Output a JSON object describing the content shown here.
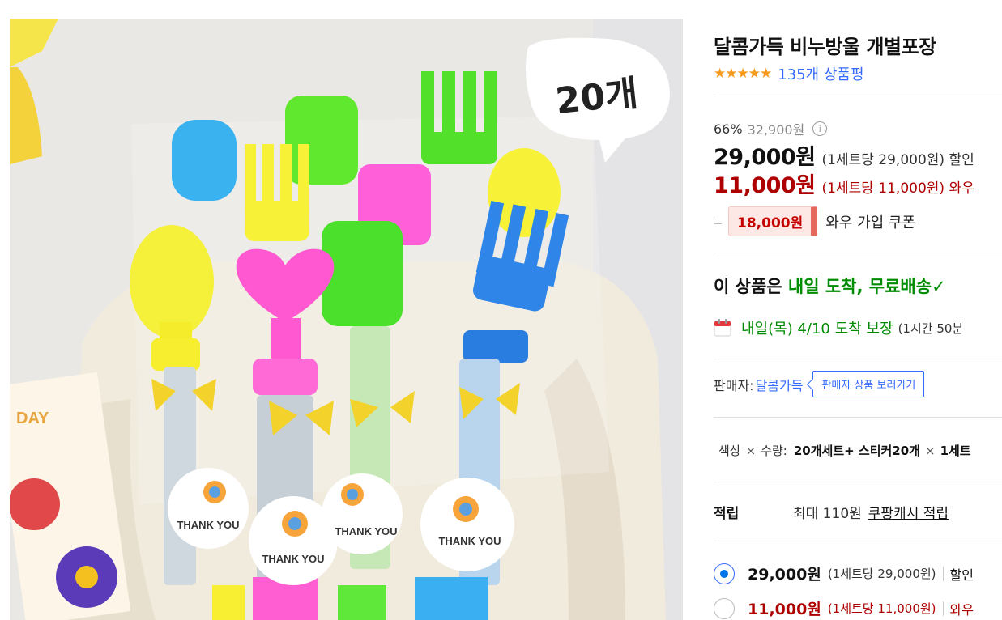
{
  "product": {
    "title": "달콤가득 비누방울 개별포장",
    "image_overlay": {
      "count_badge": "20개",
      "sticker_text": "THANK YOU",
      "card_text": "DAY"
    }
  },
  "rating": {
    "stars_text": "★★★★★",
    "stars_value": 4.5,
    "review_count": "135개 상품평"
  },
  "pricing": {
    "discount_rate": "66%",
    "original_price": "32,900원",
    "info_icon": "ⓘ",
    "normal_price": "29,000원",
    "normal_unit": "(1세트당 29,000원) 할인",
    "wow_price": "11,000원",
    "wow_unit": "(1세트당 11,000원) 와우",
    "coupon_amount": "18,000원",
    "coupon_text": "와우 가입 쿠폰"
  },
  "delivery": {
    "prefix": "이 상품은 ",
    "highlight": "내일 도착, 무료배송",
    "check_icon": "✓",
    "arrival": "내일(목) 4/10 도착 보장",
    "arrival_note": "(1시간 50분"
  },
  "seller": {
    "label": "판매자:",
    "name": "달콤가득",
    "button": "판매자 상품 보러가기"
  },
  "option": {
    "label1": "색상",
    "times1": "×",
    "label2": "수량:",
    "value": "20개세트+ 스티커20개",
    "times2": "×",
    "value2": "1세트"
  },
  "points": {
    "label": "적립",
    "max": "최대 110원",
    "link": "쿠팡캐시 적립"
  },
  "price_options": [
    {
      "amount": "29,000원",
      "unit": "(1세트당 29,000원)",
      "tag": "할인",
      "checked": true
    },
    {
      "amount": "11,000원",
      "unit": "(1세트당 11,000원)",
      "tag": "와우",
      "checked": false
    }
  ],
  "colors": {
    "link_blue": "#346aff",
    "wow_red": "#ae0000",
    "delivery_green": "#008c00",
    "star_orange": "#f79a1e"
  }
}
